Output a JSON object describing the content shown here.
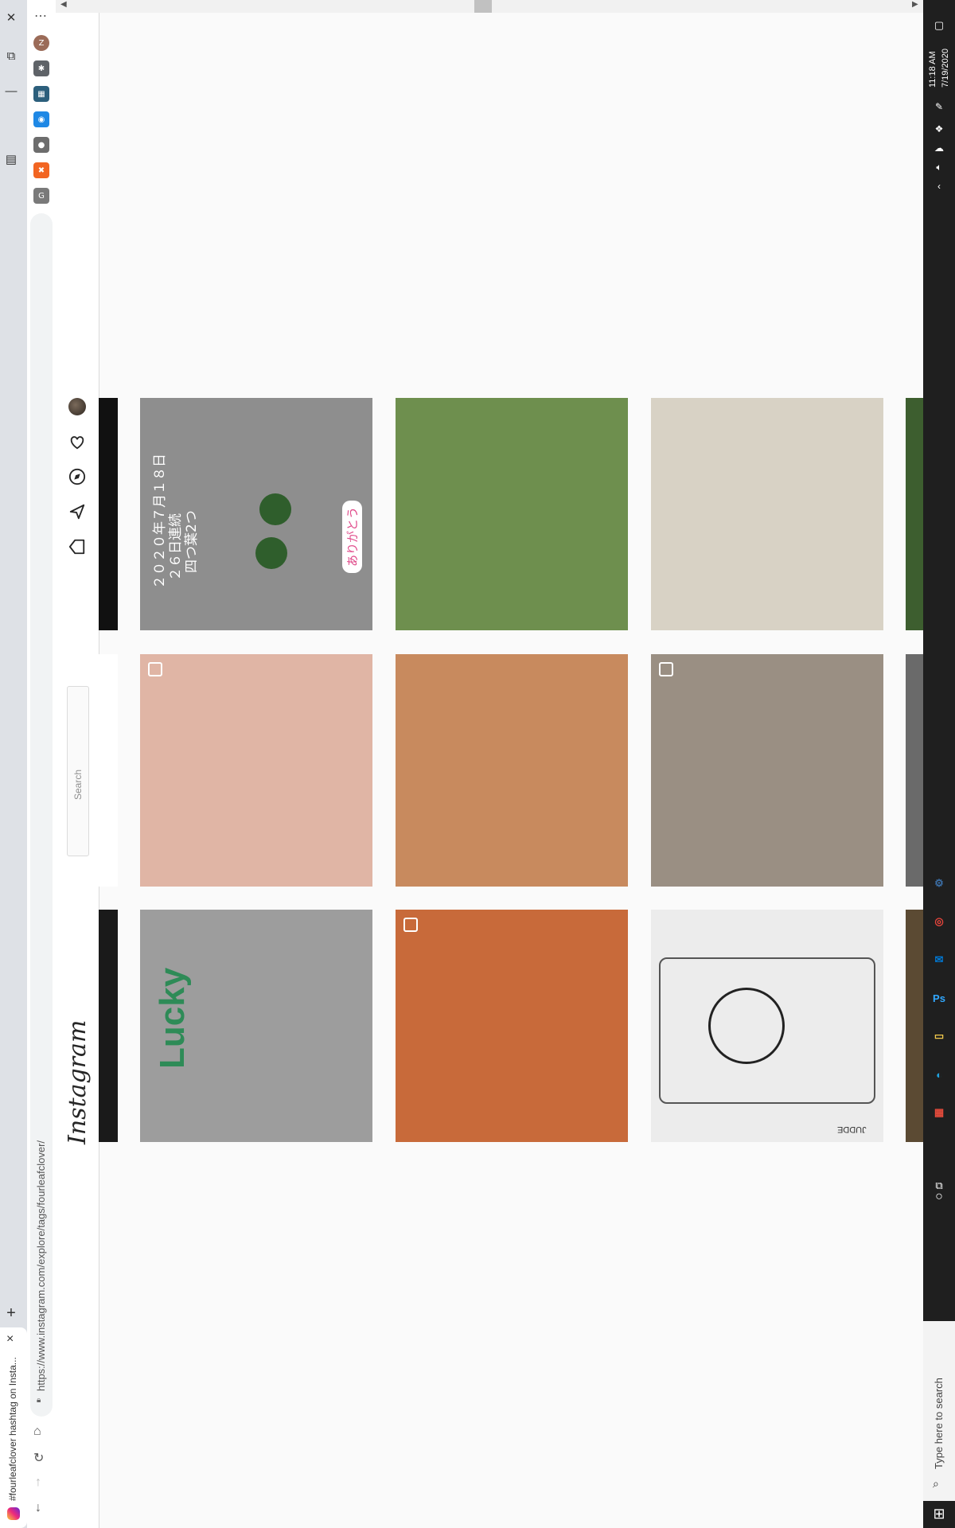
{
  "browser": {
    "tab_title": "#fourleafclover hashtag on Insta...",
    "url": "https://www.instagram.com/explore/tags/fourleafclover/",
    "new_tab_label": "+",
    "close_tab_label": "×",
    "window_controls": [
      "close-icon",
      "restore-icon",
      "minimize-icon"
    ],
    "extensions": [
      {
        "name": "profile-avatar",
        "glyph": "Z",
        "color": "#9b6b58"
      },
      {
        "name": "extensions-puzzle-icon",
        "glyph": "✱",
        "color": "#5f6368"
      },
      {
        "name": "extension-chart",
        "glyph": "▦",
        "color": "#2c5f7c"
      },
      {
        "name": "extension-blue",
        "glyph": "◉",
        "color": "#1e88e5"
      },
      {
        "name": "extension-grey",
        "glyph": "●",
        "color": "#6d6d6d"
      },
      {
        "name": "extension-orange",
        "glyph": "✖",
        "color": "#f26522"
      },
      {
        "name": "extension-g",
        "glyph": "G",
        "color": "#7a7a7a"
      }
    ]
  },
  "instagram": {
    "logo": "Instagram",
    "search_placeholder": "Search",
    "nav_icons": [
      "home-icon",
      "direct-icon",
      "explore-icon",
      "activity-icon",
      "profile-avatar"
    ]
  },
  "grid": {
    "rows": [
      [
        {
          "name": "post-clover-japanese-card",
          "bg": "#8e8e8e",
          "overlay_lines": [
            "２０２０年７月１８日",
            "２６日連続",
            "四つ葉2つ"
          ],
          "sticker": "ありがとう"
        },
        {
          "name": "post-person-umbrella-clover-field",
          "bg": "#6e8f4e"
        },
        {
          "name": "post-four-leaf-clover-closeup",
          "bg": "#d8d2c5"
        }
      ],
      [
        {
          "name": "post-clover-pendant-hand",
          "bg": "#e0b5a5",
          "multi": true
        },
        {
          "name": "post-clover-sunlit-hand",
          "bg": "#c88a5e"
        },
        {
          "name": "post-beer-cans-clover",
          "bg": "#9a8f83",
          "multi": true
        }
      ],
      [
        {
          "name": "post-lucky-clover-earring",
          "bg": "#9d9d9d",
          "caption_text": "Lucky"
        },
        {
          "name": "post-child-orange-shirt",
          "bg": "#c86a3a",
          "multi": true
        },
        {
          "name": "post-clover-ink-drawing",
          "bg": "#ececec",
          "signature": "JUDDE"
        }
      ]
    ]
  },
  "taskbar": {
    "time": "11:18 AM",
    "date": "7/19/2020",
    "search_placeholder": "Type here to search",
    "pinned_apps": [
      "misc-app-icon",
      "chrome-icon",
      "outlook-icon",
      "photoshop-icon",
      "file-explorer-icon",
      "edge-icon",
      "office-icon"
    ]
  }
}
